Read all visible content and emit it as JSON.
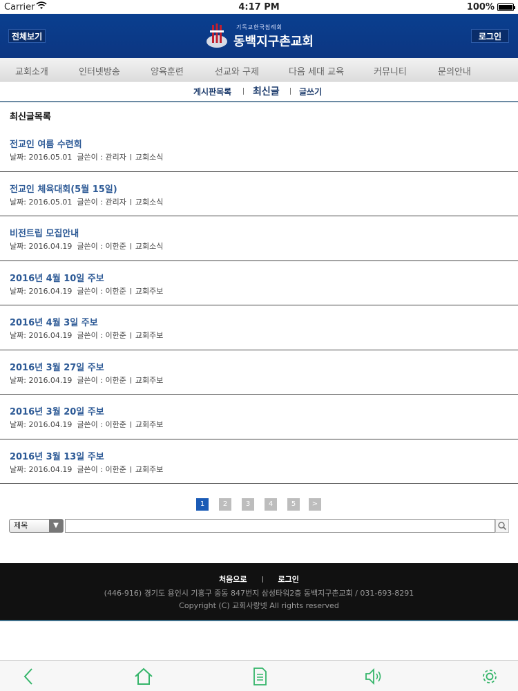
{
  "statusbar": {
    "carrier": "Carrier",
    "time": "4:17 PM",
    "battery": "100%"
  },
  "header": {
    "all_label": "전체보기",
    "login_label": "로그인",
    "logo_sub": "기독교한국침례회",
    "logo_name": "동백지구촌교회"
  },
  "gnb": [
    "교회소개",
    "인터넷방송",
    "양육훈련",
    "선교와 구제",
    "다음 세대 교육",
    "커뮤니티",
    "문의안내"
  ],
  "subnav": {
    "board_list": "게시판목록",
    "recent": "최신글",
    "write": "글쓰기"
  },
  "section_title": "최신글목록",
  "posts": [
    {
      "title": "전교인 여름 수련회",
      "date": "날짜: 2016.05.01",
      "author": "글쓴이 : 관리자",
      "category": "교회소식"
    },
    {
      "title": "전교인 체육대회(5월 15일)",
      "date": "날짜: 2016.05.01",
      "author": "글쓴이 : 관리자",
      "category": "교회소식"
    },
    {
      "title": "비전트립 모집안내",
      "date": "날짜: 2016.04.19",
      "author": "글쓴이 : 이한준",
      "category": "교회소식"
    },
    {
      "title": "2016년 4월 10일 주보",
      "date": "날짜: 2016.04.19",
      "author": "글쓴이 : 이한준",
      "category": "교회주보"
    },
    {
      "title": "2016년 4월 3일 주보",
      "date": "날짜: 2016.04.19",
      "author": "글쓴이 : 이한준",
      "category": "교회주보"
    },
    {
      "title": "2016년 3월 27일 주보",
      "date": "날짜: 2016.04.19",
      "author": "글쓴이 : 이한준",
      "category": "교회주보"
    },
    {
      "title": "2016년 3월 20일 주보",
      "date": "날짜: 2016.04.19",
      "author": "글쓴이 : 이한준",
      "category": "교회주보"
    },
    {
      "title": "2016년 3월 13일 주보",
      "date": "날짜: 2016.04.19",
      "author": "글쓴이 : 이한준",
      "category": "교회주보"
    }
  ],
  "pagination": {
    "pages": [
      "1",
      "2",
      "3",
      "4",
      "5"
    ],
    "next": ">",
    "current": "1"
  },
  "search": {
    "field_selected": "제목",
    "query": "",
    "placeholder": ""
  },
  "footer": {
    "home_link": "처음으로",
    "login_link": "로그인",
    "address": "(446-916) 경기도 용인시 기흥구 중동 847번지 삼성타워2층 동백지구촌교회 / 031-693-8291",
    "copyright": "Copyright (C) 교회사랑넷 All rights reserved"
  },
  "toolbar": {
    "icons": [
      "back-icon",
      "home-icon",
      "document-icon",
      "speaker-icon",
      "gear-icon"
    ]
  },
  "colors": {
    "header_blue": "#0c3682",
    "title_blue": "#2d5a96",
    "page_active": "#1a5bb6",
    "toolbar_icon": "#35b56a"
  }
}
